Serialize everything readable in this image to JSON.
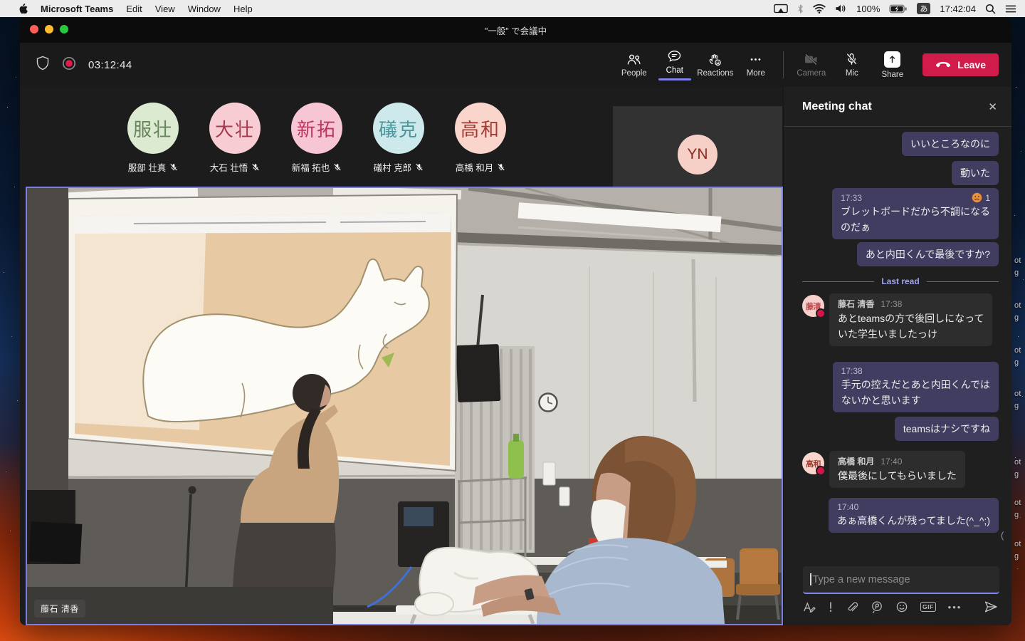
{
  "menu_bar": {
    "app_name": "Microsoft Teams",
    "menus": [
      "Edit",
      "View",
      "Window",
      "Help"
    ],
    "status": {
      "battery": "100%",
      "input_source": "あ",
      "clock": "17:42:04"
    }
  },
  "window_title": "\"一般\" で会議中",
  "toolbar": {
    "timer": "03:12:44",
    "people": "People",
    "chat": "Chat",
    "reactions": "Reactions",
    "more": "More",
    "camera": "Camera",
    "mic": "Mic",
    "share": "Share",
    "leave": "Leave"
  },
  "participants": [
    {
      "initials": "服壮",
      "name": "服部 壮真",
      "bg": "#dcead2",
      "fg": "#67855a"
    },
    {
      "initials": "大壮",
      "name": "大石 壮悟",
      "bg": "#f7cdd3",
      "fg": "#a63950"
    },
    {
      "initials": "新拓",
      "name": "新福 拓也",
      "bg": "#f7c6d4",
      "fg": "#b8355c"
    },
    {
      "initials": "礒克",
      "name": "礒村 克郎",
      "bg": "#cde9ec",
      "fg": "#4a949b"
    },
    {
      "initials": "高和",
      "name": "高橋 和月",
      "bg": "#f9d5cb",
      "fg": "#a43b33"
    }
  ],
  "spotlight_tile": {
    "initials": "YN",
    "bg": "#f6cfc6",
    "fg": "#8f2b1c"
  },
  "video": {
    "name_tag": "藤石 清香"
  },
  "chat": {
    "header": "Meeting chat",
    "last_read_label": "Last read",
    "messages": [
      {
        "type": "own",
        "text": "いいところなのに"
      },
      {
        "type": "own",
        "text": "動いた"
      },
      {
        "type": "own",
        "time": "17:33",
        "reaction_name": "frowning-face",
        "reaction_count": "1",
        "text": "ブレットボードだから不調になる\nのだぁ"
      },
      {
        "type": "own",
        "text": "あと内田くんで最後ですか?"
      },
      {
        "type": "divider"
      },
      {
        "type": "other",
        "author": "藤石 清香",
        "initials": "藤清",
        "time": "17:38",
        "avatar_bg": "#f8d0cb",
        "avatar_fg": "#c4474e",
        "text": "あとteamsの方で後回しになって\nいた学生いましたっけ"
      },
      {
        "type": "own",
        "time": "17:38",
        "text": "手元の控えだとあと内田くんでは\nないかと思います"
      },
      {
        "type": "own",
        "text": "teamsはナシですね"
      },
      {
        "type": "other",
        "author": "高橋 和月",
        "initials": "高和",
        "time": "17:40",
        "avatar_bg": "#f9d5cb",
        "avatar_fg": "#a43b33",
        "text": "僕最後にしてもらいました"
      },
      {
        "type": "own",
        "time": "17:40",
        "text": "あぁ高橋くんが残ってました(^_^;)"
      }
    ],
    "stray_fragment": "(",
    "composer": {
      "placeholder": "Type a new message",
      "gif_label": "GIF"
    }
  },
  "desktop": {
    "icon_label_fragments": [
      "ot",
      "g"
    ]
  },
  "colors": {
    "accent_purple": "#7f83e8",
    "own_bubble": "#403d60",
    "other_bubble": "#2d2d2d",
    "leave_red": "#d01b4b",
    "record_red": "#e11b4c"
  }
}
